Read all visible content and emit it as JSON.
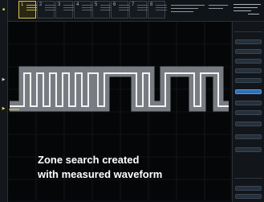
{
  "overlay": {
    "line1": "Zone search created",
    "line2": "with measured waveform"
  },
  "colors": {
    "waveform": "#e9e9e9",
    "waveform_glow": "#9da2a8",
    "active_channel": "#e8d84a",
    "highlight": "#2f6fb3"
  },
  "top_bar": {
    "channels": [
      "1",
      "2",
      "3",
      "4",
      "5",
      "6",
      "7",
      "8"
    ],
    "active_channel": "1"
  },
  "icons": [
    "left-ground-marker-icon",
    "trigger-level-marker-icon"
  ]
}
